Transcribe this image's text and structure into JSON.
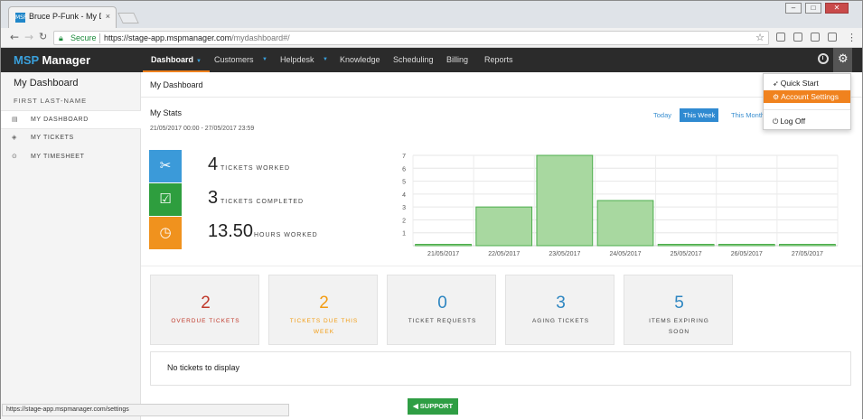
{
  "browser": {
    "tab_title": "Bruce P-Funk - My Dash",
    "tab_close": "×",
    "favicon_text": "MSP",
    "secure_label": "Secure",
    "url_host": "https://stage-app.mspmanager.com",
    "url_path": "/mydashboard#/",
    "status_url": "https://stage-app.mspmanager.com/settings"
  },
  "navbar": {
    "brand_prefix": "MSP",
    "brand_suffix": " Manager",
    "items": [
      {
        "label": "Dashboard",
        "active": true
      },
      {
        "label": "Customers"
      },
      {
        "label": "Helpdesk"
      },
      {
        "label": "Knowledge"
      },
      {
        "label": "Scheduling"
      },
      {
        "label": "Billing"
      },
      {
        "label": "Reports"
      }
    ]
  },
  "dropdown": {
    "items": [
      {
        "label": "Quick Start",
        "icon": "rocket-icon"
      },
      {
        "label": "Account Settings",
        "icon": "gear-icon"
      },
      {
        "label": "Log Off",
        "icon": "power-icon"
      }
    ]
  },
  "sidebar": {
    "title": "My Dashboard",
    "user": "FIRST LAST-NAME",
    "items": [
      {
        "label": "MY DASHBOARD",
        "icon": "dashboard-icon"
      },
      {
        "label": "MY TICKETS",
        "icon": "ticket-icon"
      },
      {
        "label": "MY TIMESHEET",
        "icon": "clock-icon"
      }
    ]
  },
  "main": {
    "page_title": "My Dashboard",
    "stats_title": "My Stats",
    "stats_range": "21/05/2017 00:00 - 27/05/2017 23:59",
    "range_buttons": [
      "Today",
      "This Week",
      "This Month"
    ],
    "stats": [
      {
        "value": "4",
        "label": "TICKETS WORKED",
        "color": "#3b9ad9"
      },
      {
        "value": "3",
        "label": "TICKETS COMPLETED",
        "color": "#2e9e3e"
      },
      {
        "value": "13.50",
        "label": "HOURS WORKED",
        "color": "#f0921e"
      }
    ],
    "counters": [
      {
        "value": "2",
        "label": "OVERDUE TICKETS",
        "color": "#c0392b"
      },
      {
        "value": "2",
        "label": "TICKETS DUE THIS WEEK",
        "color": "#f39c12"
      },
      {
        "value": "0",
        "label": "TICKET REQUESTS",
        "color": "#2e86c1"
      },
      {
        "value": "3",
        "label": "AGING TICKETS",
        "color": "#2e86c1"
      },
      {
        "value": "5",
        "label": "ITEMS EXPIRING SOON",
        "color": "#2e86c1"
      }
    ],
    "no_tickets": "No tickets to display",
    "support_label": "SUPPORT"
  },
  "chart_data": {
    "type": "bar",
    "categories": [
      "21/05/2017",
      "22/05/2017",
      "23/05/2017",
      "24/05/2017",
      "25/05/2017",
      "26/05/2017",
      "27/05/2017"
    ],
    "values": [
      0,
      3,
      7,
      3.5,
      0,
      0,
      0
    ],
    "ylim": [
      0,
      7
    ],
    "yticks": [
      1,
      2,
      3,
      4,
      5,
      6,
      7
    ],
    "grid": true,
    "colors": {
      "fill": "#a8d8a0",
      "stroke": "#4cae4c"
    }
  }
}
